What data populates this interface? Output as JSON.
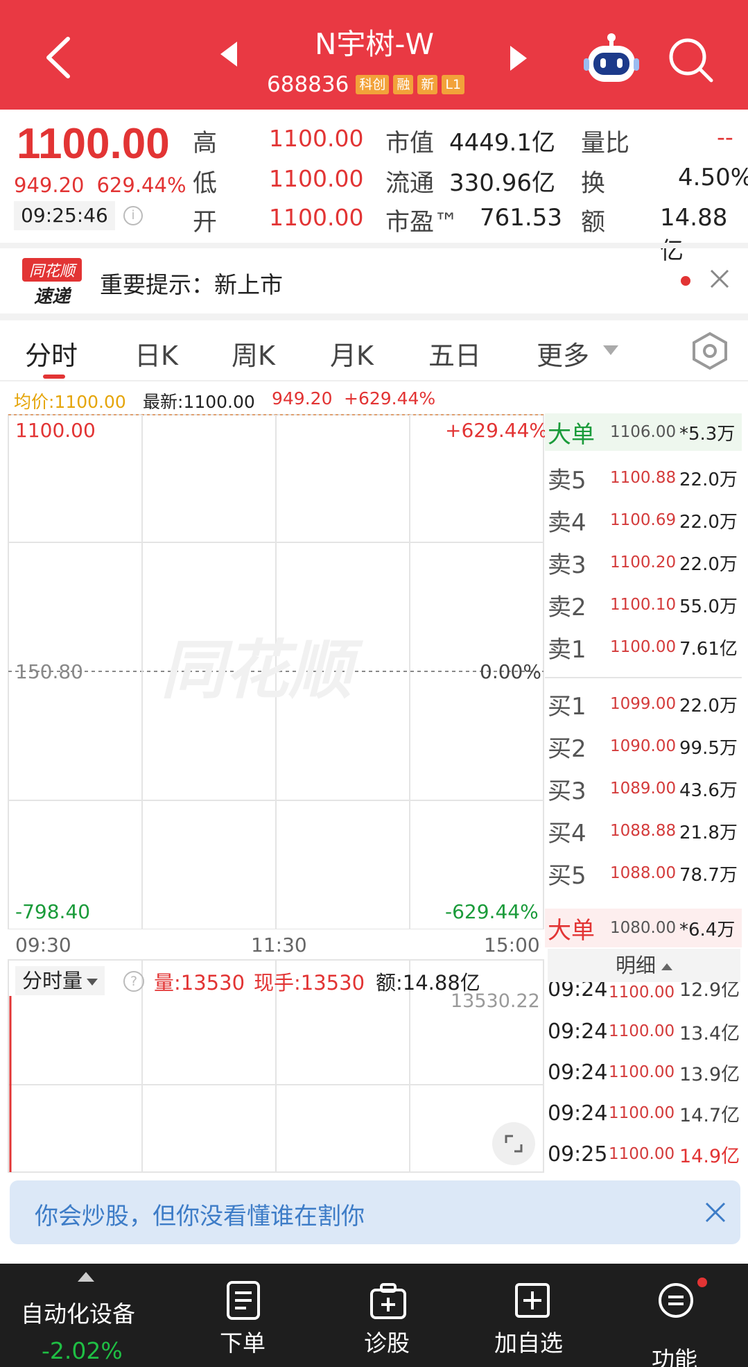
{
  "header": {
    "title": "N宇树-W",
    "code": "688836",
    "tags": [
      "科创",
      "融",
      "新",
      "L1"
    ]
  },
  "quote": {
    "price": "1100.00",
    "change": "949.20",
    "change_pct": "629.44%",
    "time": "09:25:46",
    "info_icon": "i",
    "rows": [
      {
        "label1": "高",
        "val1": "1100.00",
        "label2": "市值",
        "val2": "4449.1亿",
        "label3": "量比",
        "val3": "--"
      },
      {
        "label1": "低",
        "val1": "1100.00",
        "label2": "流通",
        "val2": "330.96亿",
        "label3": "换",
        "val3": "4.50%"
      },
      {
        "label1": "开",
        "val1": "1100.00",
        "label2": "市盈™",
        "val2": "761.53",
        "label3": "额",
        "val3": "14.88亿"
      }
    ]
  },
  "notice": {
    "brand_line1": "同花顺",
    "brand_line2": "速递",
    "text": "重要提示：新上市"
  },
  "tabs": [
    "分时",
    "日K",
    "周K",
    "月K",
    "五日",
    "更多"
  ],
  "legend": {
    "avg": "均价:1100.00",
    "latest": "最新:1100.00",
    "change": "949.20",
    "change_pct": "+629.44%"
  },
  "chart_data": {
    "type": "line",
    "title": "",
    "x_ticks": [
      "09:30",
      "11:30",
      "15:00"
    ],
    "y_left_ticks": [
      "1100.00",
      "150.80",
      "-798.40"
    ],
    "y_right_ticks": [
      "+629.44%",
      "0.00%",
      "-629.44%"
    ],
    "ylim": [
      -798.4,
      1100.0
    ],
    "reference_price": 150.8,
    "watermark": "同花顺",
    "colors": {
      "up": "#e23434",
      "down": "#1a9b3a",
      "avg": "#e5a50a"
    }
  },
  "orderbook": {
    "top_big": {
      "label": "大单",
      "price": "1106.00",
      "vol": "*5.3万"
    },
    "asks": [
      {
        "label": "卖5",
        "price": "1100.88",
        "vol": "22.0万"
      },
      {
        "label": "卖4",
        "price": "1100.69",
        "vol": "22.0万"
      },
      {
        "label": "卖3",
        "price": "1100.20",
        "vol": "22.0万"
      },
      {
        "label": "卖2",
        "price": "1100.10",
        "vol": "55.0万"
      },
      {
        "label": "卖1",
        "price": "1100.00",
        "vol": "7.61亿"
      }
    ],
    "bids": [
      {
        "label": "买1",
        "price": "1099.00",
        "vol": "22.0万"
      },
      {
        "label": "买2",
        "price": "1090.00",
        "vol": "99.5万"
      },
      {
        "label": "买3",
        "price": "1089.00",
        "vol": "43.6万"
      },
      {
        "label": "买4",
        "price": "1088.88",
        "vol": "21.8万"
      },
      {
        "label": "买5",
        "price": "1088.00",
        "vol": "78.7万"
      }
    ],
    "bottom_big": {
      "label": "大单",
      "price": "1080.00",
      "vol": "*6.4万"
    }
  },
  "volume": {
    "dropdown": "分时量",
    "help_icon": "?",
    "vol": "量:13530",
    "current": "现手:13530",
    "amount": "额:14.88亿",
    "max_label": "13530.22"
  },
  "details": {
    "header": "明细",
    "rows": [
      {
        "time": "09:24",
        "price": "1100.00",
        "amt": "12.9亿"
      },
      {
        "time": "09:24",
        "price": "1100.00",
        "amt": "13.4亿"
      },
      {
        "time": "09:24",
        "price": "1100.00",
        "amt": "13.9亿"
      },
      {
        "time": "09:24",
        "price": "1100.00",
        "amt": "14.7亿"
      },
      {
        "time": "09:25",
        "price": "1100.00",
        "amt": "14.9亿"
      }
    ]
  },
  "promo": {
    "text": "你会炒股，但你没看懂谁在割你"
  },
  "bottom_bar": {
    "sector_name": "自动化设备",
    "sector_pct": "-2.02%",
    "items": [
      "下单",
      "诊股",
      "加自选",
      "功能"
    ]
  }
}
